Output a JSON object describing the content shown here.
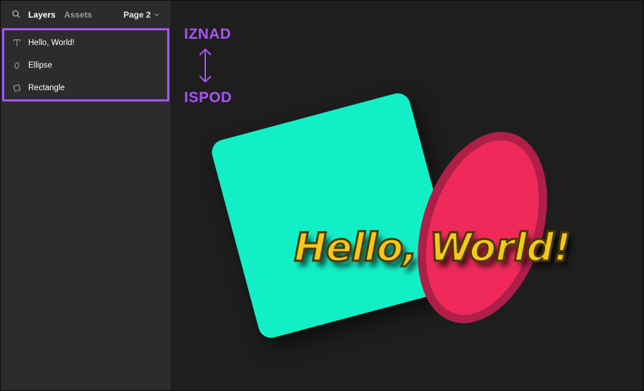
{
  "sidebar": {
    "tabs": {
      "layers": "Layers",
      "assets": "Assets"
    },
    "page": "Page 2",
    "layers": [
      {
        "label": "Hello, World!",
        "icon": "text-icon"
      },
      {
        "label": "Ellipse",
        "icon": "ellipse-icon"
      },
      {
        "label": "Rectangle",
        "icon": "rectangle-icon"
      }
    ]
  },
  "annotations": {
    "above": "IZNAD",
    "below": "ISPOD",
    "color": "#a855f7"
  },
  "canvas": {
    "text": "Hello, World!",
    "colors": {
      "rectangle": "#12efc6",
      "ellipse": "#ef2a5b",
      "ellipse_stroke": "#b01f48",
      "text": "#f7c81a"
    }
  }
}
